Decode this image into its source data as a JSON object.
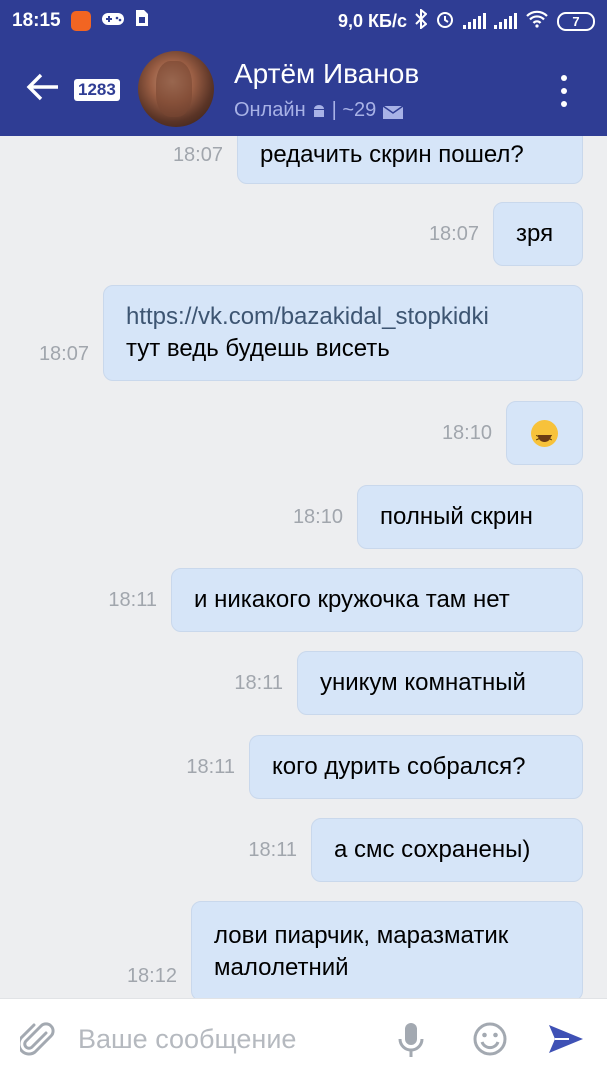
{
  "status_bar": {
    "time": "18:15",
    "network_speed": "9,0 КБ/с",
    "battery": "7",
    "icons": [
      "app-icon",
      "gamepad-icon",
      "sim-icon",
      "bluetooth-icon",
      "alarm-icon",
      "signal-icon",
      "signal-icon",
      "wifi-icon",
      "battery-icon"
    ]
  },
  "header": {
    "unread_count": "1283",
    "contact_name": "Артём Иванов",
    "status_text": "Онлайн",
    "status_extra": "| ~29",
    "colors": {
      "bar": "#2f3d94",
      "status": "#a8b2e6"
    }
  },
  "messages": [
    {
      "time": "18:07",
      "text": "редачить скрин пошел?"
    },
    {
      "time": "18:07",
      "text": "зря"
    },
    {
      "time": "18:07",
      "link": "https://vk.com/bazakidal_stopkidki",
      "text": "тут ведь будешь висеть"
    },
    {
      "time": "18:10",
      "emoji": "laughing-emoji"
    },
    {
      "time": "18:10",
      "text": "полный скрин"
    },
    {
      "time": "18:11",
      "text": "и никакого кружочка там нет"
    },
    {
      "time": "18:11",
      "text": "уникум комнатный"
    },
    {
      "time": "18:11",
      "text": "кого дурить собрался?"
    },
    {
      "time": "18:11",
      "text": "а смс сохранены)"
    },
    {
      "time": "18:12",
      "text": "лови пиарчик, маразматик",
      "text2": "малолетний"
    }
  ],
  "composer": {
    "placeholder": "Ваше сообщение",
    "value": "",
    "accent": "#3f51b5"
  }
}
